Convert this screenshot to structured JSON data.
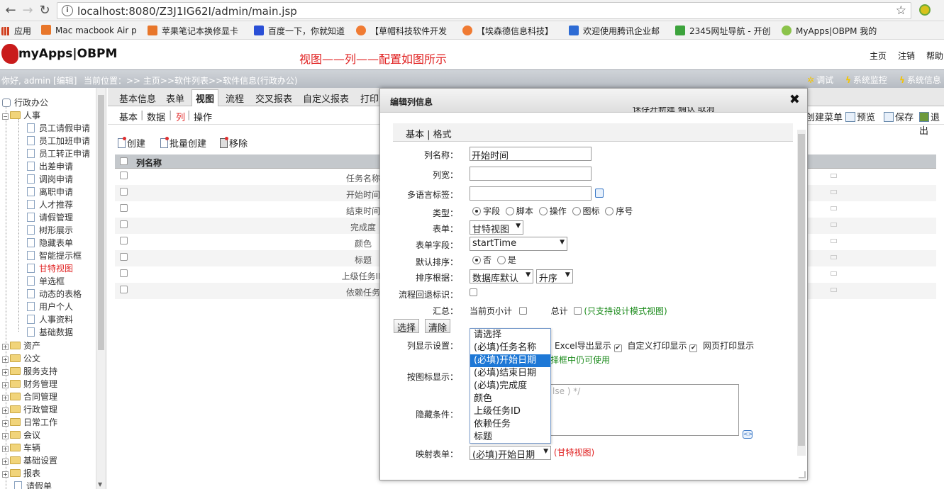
{
  "browser": {
    "url": "localhost:8080/Z3J1IG62I/admin/main.jsp",
    "bookmarks": [
      {
        "label": "应用",
        "color": "#d04020"
      },
      {
        "label": "Mac macbook Air p",
        "color": "#e8762a"
      },
      {
        "label": "苹果笔记本换修显卡",
        "color": "#e8762a"
      },
      {
        "label": "百度一下，你就知道",
        "color": "#2a4fd6"
      },
      {
        "label": "【草帽科技软件开发",
        "color": "#f07b33"
      },
      {
        "label": "【埃森德信息科技】",
        "color": "#f07b33"
      },
      {
        "label": "欢迎使用腾讯企业邮",
        "color": "#2d6bd4"
      },
      {
        "label": "2345网址导航 - 开创",
        "color": "#3ca33c"
      },
      {
        "label": "MyApps|OBPM 我的",
        "color": "#8bc34a"
      }
    ]
  },
  "header": {
    "logo": "myApps|OBPM",
    "note": "视图——列——配置如图所示",
    "links": [
      "主页",
      "注销",
      "帮助"
    ]
  },
  "infobar": {
    "greeting": "你好, admin [编辑]",
    "breadcrumb": "当前位置：>> 主页>>软件列表>>软件信息(行政办公)",
    "tools": [
      "调试",
      "系统监控",
      "系统信息"
    ]
  },
  "tree": {
    "root": "行政办公",
    "group": "人事",
    "children": [
      "员工请假申请",
      "员工加班申请",
      "员工转正申请",
      "出差申请",
      "调岗申请",
      "离职申请",
      "人才推荐",
      "请假管理",
      "树形展示",
      "隐藏表单",
      "智能提示框",
      "甘特视图",
      "单选框",
      "动态的表格",
      "用户个人",
      "人事资料",
      "基础数据"
    ],
    "active": "甘特视图",
    "folders": [
      "资产",
      "公文",
      "服务支持",
      "财务管理",
      "合同管理",
      "行政管理",
      "日常工作",
      "会议",
      "车辆",
      "基础设置",
      "报表"
    ],
    "last": "请假单"
  },
  "main": {
    "tabs": [
      "基本信息",
      "表单",
      "视图",
      "流程",
      "交叉报表",
      "自定义报表",
      "打印"
    ],
    "active_tab": "视图",
    "subtabs": [
      "基本",
      "数据",
      "列",
      "操作"
    ],
    "active_subtab": "列",
    "right_tools": [
      "创建菜单",
      "预览",
      "保存",
      "退出"
    ],
    "actions": [
      "创建",
      "批量创建",
      "移除"
    ],
    "grid_header": "列名称",
    "rows": [
      "任务名称",
      "开始时间",
      "结束时间",
      "完成度",
      "颜色",
      "标题",
      "上级任务ID",
      "依赖任务"
    ]
  },
  "dialog": {
    "title": "编辑列信息",
    "top_clip": "保存并新建        确认        取消",
    "subtabs": "基本 | 格式",
    "fields": {
      "col_name_label": "列名称：",
      "col_name_value": "开始时间",
      "width_label": "列宽：",
      "i18n_label": "多语言标签：",
      "type_label": "类型：",
      "type_options": [
        "字段",
        "脚本",
        "操作",
        "图标",
        "序号"
      ],
      "form_label": "表单：",
      "form_value": "甘特视图",
      "field_label": "表单字段：",
      "field_value": "startTime",
      "sort_label": "默认排序：",
      "sort_no": "否",
      "sort_yes": "是",
      "sortby_label": "排序根据：",
      "sortby_value": "数据库默认",
      "sortdir_value": "升序",
      "flow_label": "流程回退标识：",
      "sum_label": "汇总：",
      "sum_page": "当前页小计",
      "sum_total": "总计",
      "sum_note": "(只支持设计模式视图)",
      "btn_select": "选择",
      "btn_clear": "清除",
      "display_label": "列显示设置：",
      "excel": "Excel导出显示",
      "custom_print": "自定义打印显示",
      "web_print": "网页打印显示",
      "hint_partial": "择框中仍可使用",
      "icon_label": "按图标显示：",
      "hide_label": "隐藏条件：",
      "script_placeholder": "lse ) */",
      "map_label": "映射表单：",
      "map_value": "(必填)开始日期",
      "map_note": "(甘特视图)"
    },
    "dropdown": [
      "请选择",
      "(必填)任务名称",
      "(必填)开始日期",
      "(必填)结束日期",
      "(必填)完成度",
      "颜色",
      "上级任务ID",
      "依赖任务",
      "标题"
    ],
    "dropdown_selected": "(必填)开始日期"
  }
}
